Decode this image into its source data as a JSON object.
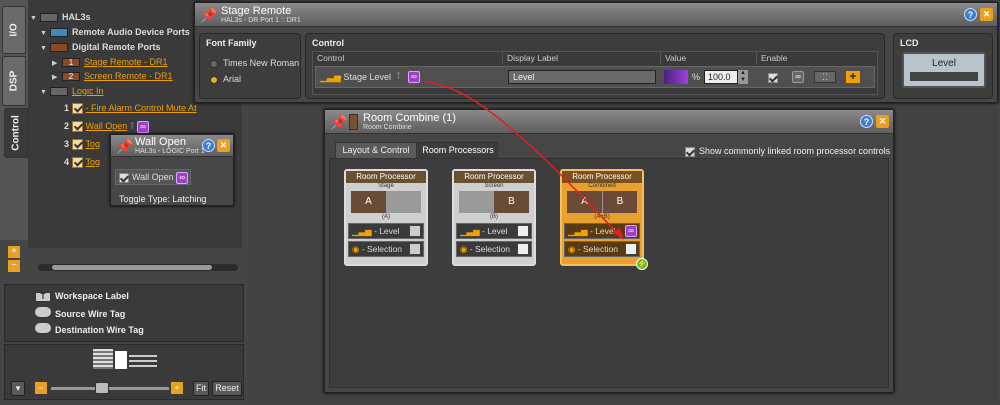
{
  "side_tabs": [
    "I/O",
    "DSP",
    "Control"
  ],
  "tree": {
    "root": "HAL3s",
    "remote_audio": "Remote Audio Device Ports",
    "digital_remote": "Digital Remote Ports",
    "ports": [
      {
        "num": "1",
        "label": "Stage Remote - DR1"
      },
      {
        "num": "2",
        "label": "Screen Remote - DR1"
      }
    ],
    "logic_in": "Logic In",
    "logic_items": [
      {
        "num": "1",
        "label": "- Fire Alarm Control Mute At"
      },
      {
        "num": "2",
        "label": "Wall Open"
      },
      {
        "num": "3",
        "label": "Tog"
      },
      {
        "num": "4",
        "label": "Tog"
      }
    ]
  },
  "legend": {
    "workspace_label": "Workspace Label",
    "source_tag": "Source Wire Tag",
    "dest_tag": "Destination Wire Tag"
  },
  "zoom": {
    "fit": "Fit",
    "reset": "Reset"
  },
  "wall_open": {
    "title": "Wall Open",
    "sub": "HAL3s - LOGIC Port 1",
    "item": "Wall Open",
    "toggle": "Toggle Type: Latching"
  },
  "stage_remote": {
    "title": "Stage Remote",
    "sub": "HAL3s - DR Port 1 :: DR1",
    "font_family": {
      "header": "Font Family",
      "options": [
        "Times New Roman",
        "Arial"
      ],
      "selected": "Arial"
    },
    "control": {
      "header": "Control",
      "cols": [
        "Control",
        "Display Label",
        "Value",
        "Enable"
      ],
      "row_control": "- Stage Level",
      "display_label": "Level",
      "pct": "%",
      "value": "100.0"
    },
    "lcd": {
      "header": "LCD",
      "text": "Level"
    }
  },
  "room_combine": {
    "title": "Room Combine (1)",
    "sub": "Room Combine",
    "tabs": [
      "Layout & Control",
      "Room Processors"
    ],
    "active_tab": "Room Processors",
    "show_linked": "Show commonly linked room processor controls",
    "processors": [
      {
        "title": "Room Processor",
        "sub": "Stage",
        "a": "A",
        "b": "",
        "label": "(A)",
        "level": "- Level",
        "selection": "- Selection"
      },
      {
        "title": "Room Processor",
        "sub": "Screen",
        "a": "",
        "b": "B",
        "label": "(B)",
        "level": "- Level",
        "selection": "- Selection"
      },
      {
        "title": "Room Processor",
        "sub": "Combined",
        "a": "A",
        "b": "B",
        "label": "(A+B)",
        "level": "- Level",
        "selection": "- Selection"
      }
    ]
  },
  "colors": {
    "accent": "#f0a000",
    "link": "#a040c8",
    "wire": "#e02020"
  }
}
